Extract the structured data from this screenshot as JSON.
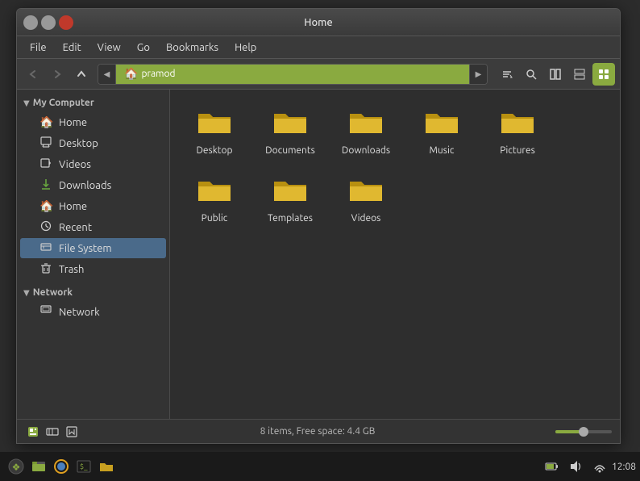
{
  "window": {
    "title": "Home",
    "controls": {
      "minimize": "–",
      "maximize": "□",
      "close": "✕"
    }
  },
  "menubar": {
    "items": [
      "File",
      "Edit",
      "View",
      "Go",
      "Bookmarks",
      "Help"
    ]
  },
  "toolbar": {
    "back_label": "◀",
    "forward_label": "▶",
    "up_label": "▲",
    "location_left_arrow": "◀",
    "location_right_arrow": "▶",
    "location_text": "pramod",
    "search_label": "🔍",
    "toggle_label": "⊞",
    "split_label": "⊟",
    "grid_label": "⊞"
  },
  "sidebar": {
    "my_computer_label": "My Computer",
    "items_my_computer": [
      {
        "id": "home",
        "label": "Home",
        "icon": "🏠"
      },
      {
        "id": "desktop",
        "label": "Desktop",
        "icon": "🖥"
      },
      {
        "id": "videos",
        "label": "Videos",
        "icon": "🎬"
      },
      {
        "id": "downloads",
        "label": "Downloads",
        "icon": "⬇"
      },
      {
        "id": "home2",
        "label": "Home",
        "icon": "🏠"
      },
      {
        "id": "recent",
        "label": "Recent",
        "icon": "🕐"
      },
      {
        "id": "filesystem",
        "label": "File System",
        "icon": "💾"
      },
      {
        "id": "trash",
        "label": "Trash",
        "icon": "🗑"
      }
    ],
    "network_label": "Network",
    "items_network": [
      {
        "id": "network",
        "label": "Network",
        "icon": "🖧"
      }
    ]
  },
  "files": [
    {
      "name": "Desktop",
      "type": "folder"
    },
    {
      "name": "Documents",
      "type": "folder"
    },
    {
      "name": "Downloads",
      "type": "folder"
    },
    {
      "name": "Music",
      "type": "folder"
    },
    {
      "name": "Pictures",
      "type": "folder"
    },
    {
      "name": "Public",
      "type": "folder"
    },
    {
      "name": "Templates",
      "type": "folder"
    },
    {
      "name": "Videos",
      "type": "folder"
    }
  ],
  "statusbar": {
    "info": "8 items, Free space: 4.4 GB"
  },
  "taskbar": {
    "time": "12:08",
    "icons": [
      "🐧",
      "📁",
      "🦊",
      "💻",
      "📂"
    ]
  },
  "colors": {
    "accent": "#8aaa40",
    "sidebar_bg": "#333333",
    "content_bg": "#2e2e2e",
    "window_bg": "#3c3c3c"
  }
}
